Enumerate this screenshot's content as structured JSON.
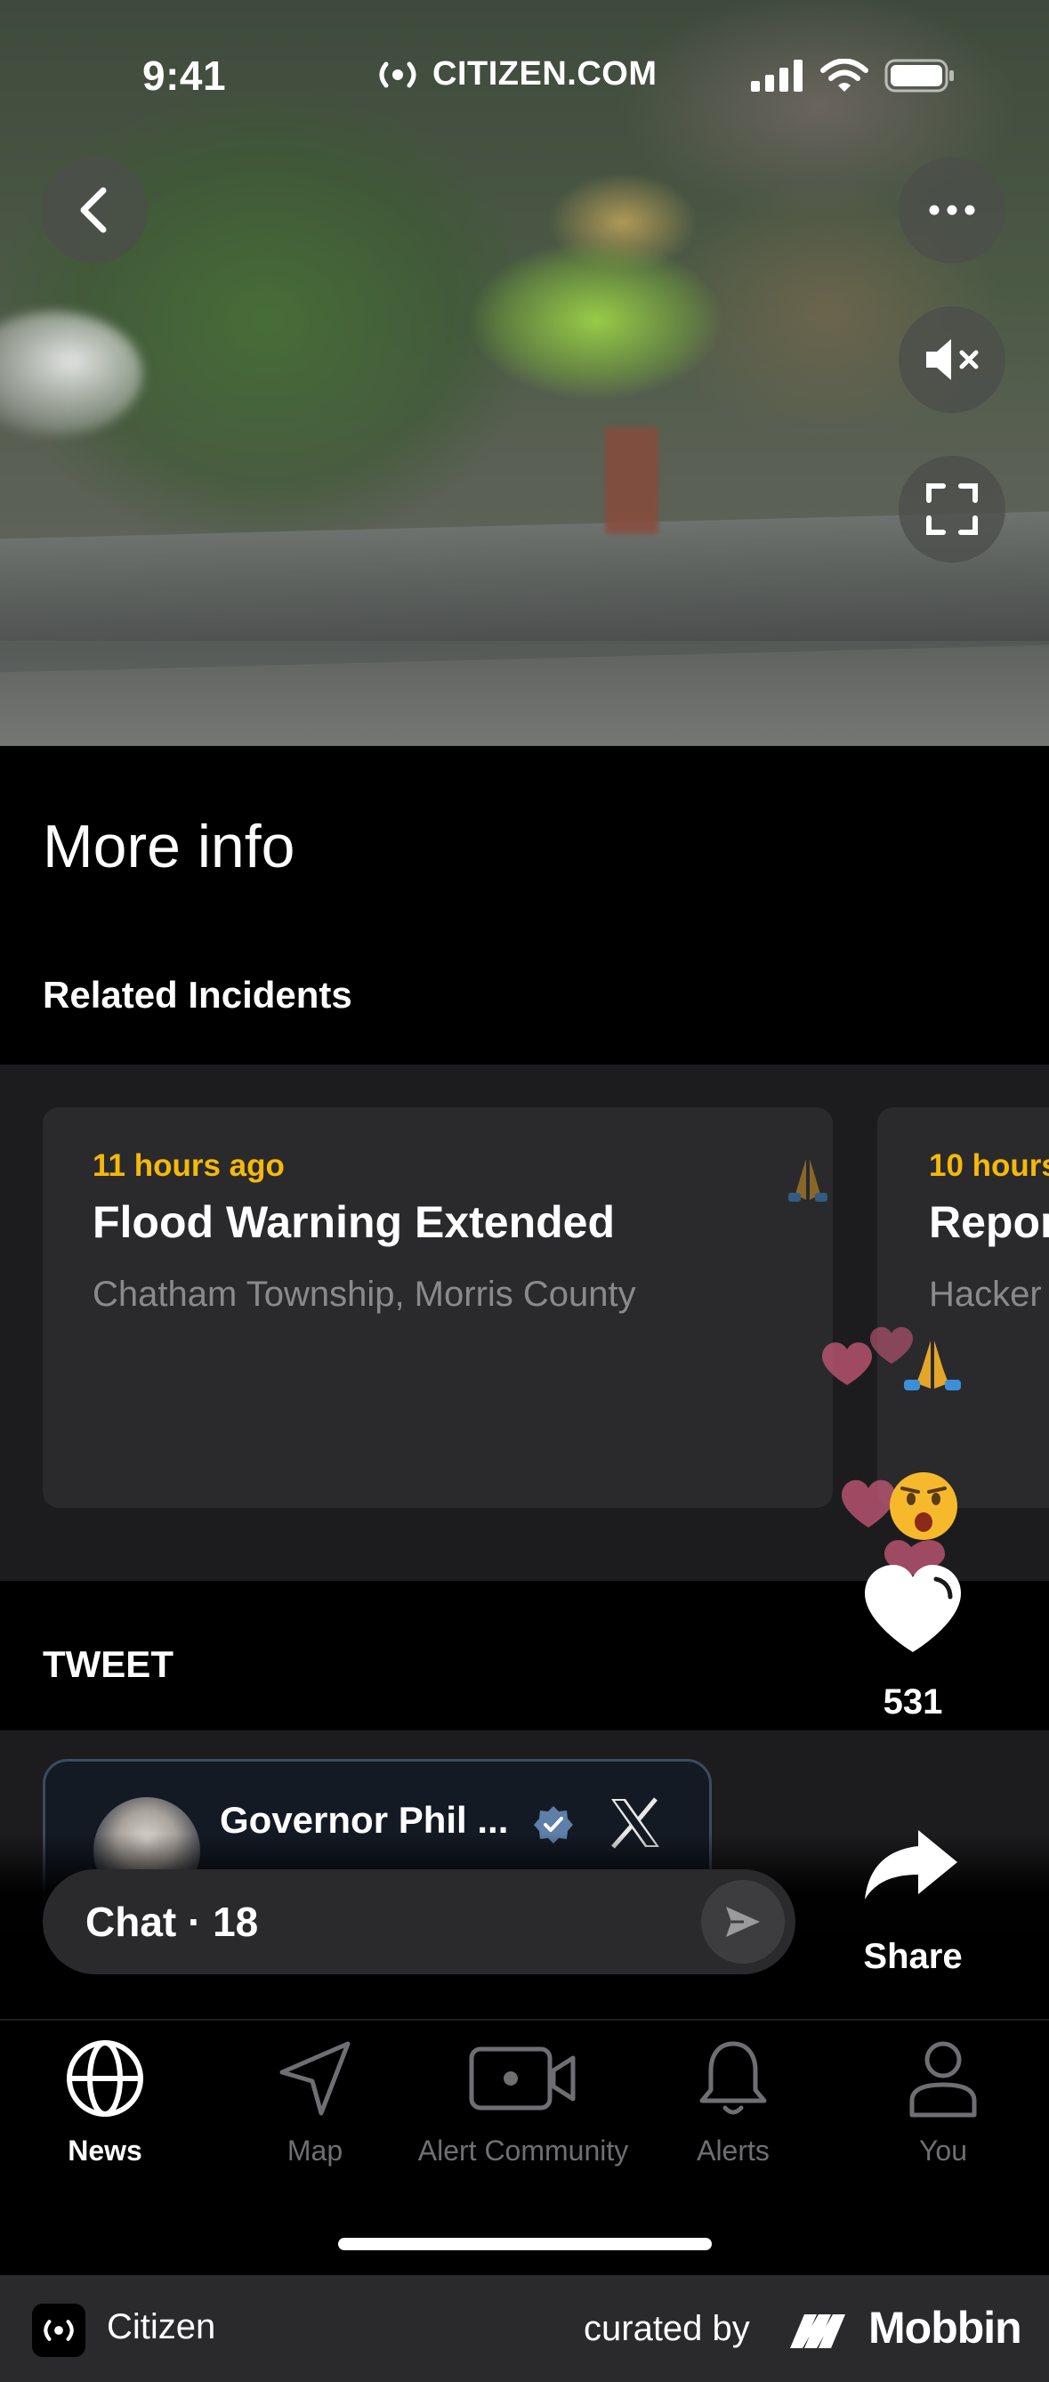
{
  "status_bar": {
    "time": "9:41",
    "site": "CITIZEN.COM"
  },
  "more_info": {
    "title": "More info",
    "related_title": "Related Incidents",
    "incidents": [
      {
        "time": "11 hours ago",
        "title": "Flood Warning Extended",
        "location": "Chatham Township, Morris County"
      },
      {
        "time": "10 hours",
        "title": "Repor",
        "location": "Hacker"
      }
    ]
  },
  "tweet": {
    "label": "TWEET",
    "author": "Governor Phil ..."
  },
  "reactions": {
    "like_count": "531",
    "share_label": "Share"
  },
  "chat": {
    "label": "Chat · 18"
  },
  "tabs": [
    {
      "label": "News",
      "icon": "globe-icon",
      "active": true
    },
    {
      "label": "Map",
      "icon": "navigation-arrow-icon",
      "active": false
    },
    {
      "label": "Alert Community",
      "icon": "video-camera-icon",
      "active": false
    },
    {
      "label": "Alerts",
      "icon": "bell-icon",
      "active": false
    },
    {
      "label": "You",
      "icon": "user-icon",
      "active": false
    }
  ],
  "footer": {
    "app_name": "Citizen",
    "curated_by": "curated by",
    "brand": "Mobbin"
  },
  "colors": {
    "accent_time": "#f5b90a",
    "card_bg": "#2a2a2c",
    "strip_bg": "#1c1c1e"
  }
}
